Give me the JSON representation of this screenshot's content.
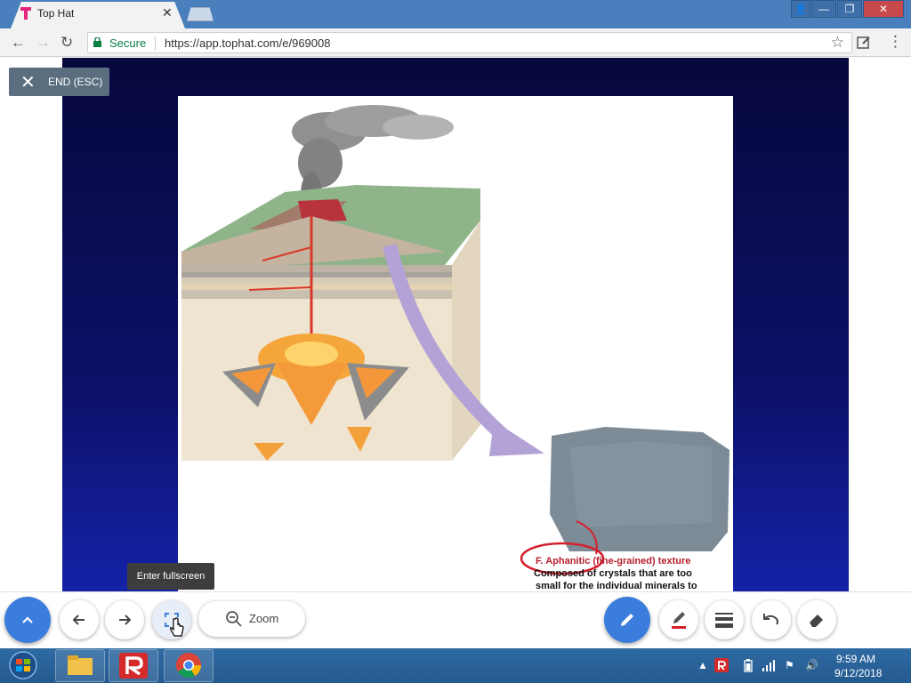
{
  "browser": {
    "tab_title": "Top Hat",
    "close_glyph": "✕",
    "window_buttons": [
      "👤",
      "—",
      "❐",
      "✕"
    ],
    "secure_label": "Secure",
    "url": "https://app.tophat.com/e/969008"
  },
  "presentation": {
    "end_label": "END (ESC)",
    "end_icon": "✕",
    "figure_caption": {
      "line1": "F. Aphanitic (fine-grained) texture",
      "line2": "Composed of crystals that are too",
      "line3": "small for the individual minerals to"
    }
  },
  "toolbar": {
    "tooltip": "Enter fullscreen",
    "zoom_label": "Zoom",
    "icons": {
      "expand": "chevron-up-icon",
      "prev": "arrow-left-icon",
      "next": "arrow-right-icon",
      "fullscreen": "fullscreen-icon",
      "zoom": "zoom-out-icon",
      "pen": "pencil-icon",
      "highlighter": "pen-red-icon",
      "stroke": "stroke-width-icon",
      "undo": "undo-icon",
      "eraser": "eraser-icon"
    }
  },
  "taskbar": {
    "time": "9:59 AM",
    "date": "9/12/2018"
  },
  "colors": {
    "title_bar": "#4a7fbd",
    "accent_blue": "#3b7ddd",
    "caption_red": "#b51d2c",
    "slide_bg": "#0c1066"
  }
}
